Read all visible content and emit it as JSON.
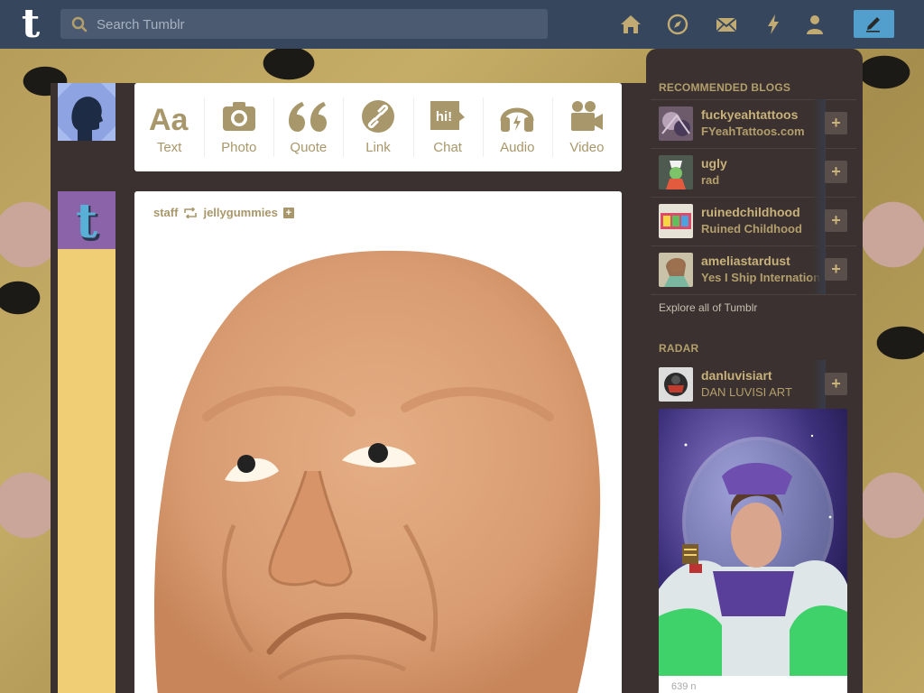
{
  "topbar": {
    "logo": "t",
    "search": {
      "placeholder": "Search Tumblr",
      "value": ""
    },
    "nav_icons": [
      "home-icon",
      "explore-icon",
      "inbox-icon",
      "activity-icon",
      "account-icon"
    ],
    "compose_icon": "pencil-icon"
  },
  "post_form": {
    "types": [
      {
        "label": "Text",
        "icon": "text-icon"
      },
      {
        "label": "Photo",
        "icon": "camera-icon"
      },
      {
        "label": "Quote",
        "icon": "quote-icon"
      },
      {
        "label": "Link",
        "icon": "link-icon"
      },
      {
        "label": "Chat",
        "icon": "chat-icon",
        "icon_text": "hi!"
      },
      {
        "label": "Audio",
        "icon": "headphones-icon"
      },
      {
        "label": "Video",
        "icon": "video-camera-icon"
      }
    ]
  },
  "post": {
    "author": "staff",
    "reblogged_from": "jellygummies",
    "follow_glyph": "+"
  },
  "sidebar": {
    "recommended_title": "RECOMMENDED BLOGS",
    "recommended": [
      {
        "name": "fuckyeahtattoos",
        "desc": "FYeahTattoos.com"
      },
      {
        "name": "ugly",
        "desc": "rad"
      },
      {
        "name": "ruinedchildhood",
        "desc": "Ruined Childhood"
      },
      {
        "name": "ameliastardust",
        "desc": "Yes I Ship Internation"
      }
    ],
    "follow_glyph": "+",
    "explore": "Explore all of Tumblr",
    "radar_title": "RADAR",
    "radar_blog": {
      "name": "danluvisiart",
      "desc": "DAN LUVISI ART"
    },
    "radar_notes": "639 n"
  },
  "colors": {
    "topbar": "#36465d",
    "dashboard": "#3a3130",
    "accent_gold": "#a8976a",
    "compose_blue": "#529ecc"
  }
}
